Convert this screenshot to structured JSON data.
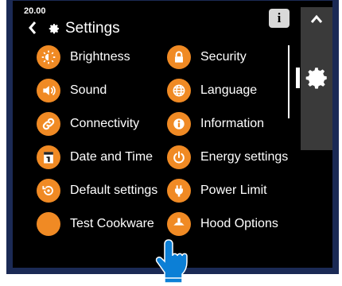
{
  "status": {
    "time": "20.00"
  },
  "header": {
    "title": "Settings",
    "info_glyph": "i"
  },
  "accent_color": "#f08a24",
  "left_column": [
    {
      "label": "Brightness",
      "icon": "brightness-icon"
    },
    {
      "label": "Sound",
      "icon": "speaker-icon"
    },
    {
      "label": "Connectivity",
      "icon": "link-icon"
    },
    {
      "label": "Date and Time",
      "icon": "calendar-icon"
    },
    {
      "label": "Default settings",
      "icon": "reset-icon"
    },
    {
      "label": "Test Cookware",
      "icon": "blank-icon"
    }
  ],
  "right_column": [
    {
      "label": "Security",
      "icon": "lock-icon"
    },
    {
      "label": "Language",
      "icon": "globe-icon"
    },
    {
      "label": "Information",
      "icon": "info-icon"
    },
    {
      "label": "Energy settings",
      "icon": "power-icon"
    },
    {
      "label": "Power Limit",
      "icon": "plug-icon"
    },
    {
      "label": "Hood Options",
      "icon": "hood-icon"
    }
  ]
}
